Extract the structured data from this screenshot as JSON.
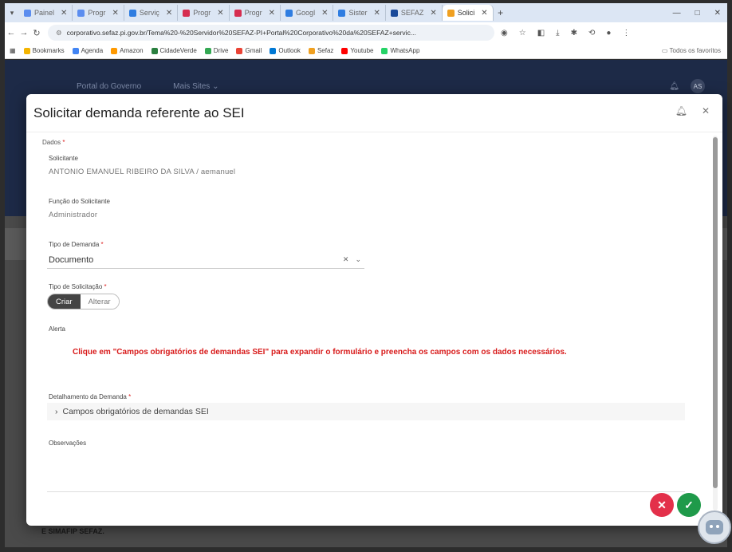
{
  "browser": {
    "tabs": [
      {
        "label": "Painel",
        "color": "#5b8def"
      },
      {
        "label": "Progr",
        "color": "#5b8def"
      },
      {
        "label": "Serviç",
        "color": "#2f7de1"
      },
      {
        "label": "Progr",
        "color": "#d62d4f"
      },
      {
        "label": "Progr",
        "color": "#d62d4f"
      },
      {
        "label": "Googl",
        "color": "#2f7de1"
      },
      {
        "label": "Sister",
        "color": "#2f7de1"
      },
      {
        "label": "SEFAZ",
        "color": "#1a4a9a"
      },
      {
        "label": "Solici",
        "color": "#f0a020",
        "active": true
      }
    ],
    "url": "corporativo.sefaz.pi.gov.br/Tema%20-%20Servidor%20SEFAZ-PI+Portal%20Corporativo%20da%20SEFAZ+servic...",
    "bookmarks": [
      {
        "label": "Bookmarks",
        "color": "#f4b400"
      },
      {
        "label": "Agenda",
        "color": "#4285f4"
      },
      {
        "label": "Amazon",
        "color": "#ff9900"
      },
      {
        "label": "CidadeVerde",
        "color": "#2a7f3f"
      },
      {
        "label": "Drive",
        "color": "#34a853"
      },
      {
        "label": "Gmail",
        "color": "#ea4335"
      },
      {
        "label": "Outlook",
        "color": "#0078d4"
      },
      {
        "label": "Sefaz",
        "color": "#f0a020"
      },
      {
        "label": "Youtube",
        "color": "#ff0000"
      },
      {
        "label": "WhatsApp",
        "color": "#25d366"
      }
    ],
    "bookmark_folder": "Todos os favoritos"
  },
  "portal": {
    "nav": [
      "Portal do Governo",
      "Mais Sites"
    ],
    "avatar": "AS",
    "footer_text": "E SIMAFIP SEFAZ."
  },
  "modal": {
    "title": "Solicitar demanda referente ao SEI",
    "section": "Dados",
    "requester_label": "Solicitante",
    "requester_value": "ANTONIO EMANUEL RIBEIRO DA SILVA / aemanuel",
    "role_label": "Função do Solicitante",
    "role_value": "Administrador",
    "demand_type_label": "Tipo de Demanda",
    "demand_type_value": "Documento",
    "request_type_label": "Tipo de Solicitação",
    "request_type_options": [
      "Criar",
      "Alterar"
    ],
    "request_type_selected": "Criar",
    "alert_label": "Alerta",
    "alert_text": "Clique em \"Campos obrigatórios de demandas SEI\" para expandir o formulário e preencha os campos com os dados necessários.",
    "detail_label": "Detalhamento da Demanda",
    "detail_accordion": "Campos obrigatórios de demandas SEI",
    "notes_label": "Observações",
    "required_mark": "*"
  }
}
